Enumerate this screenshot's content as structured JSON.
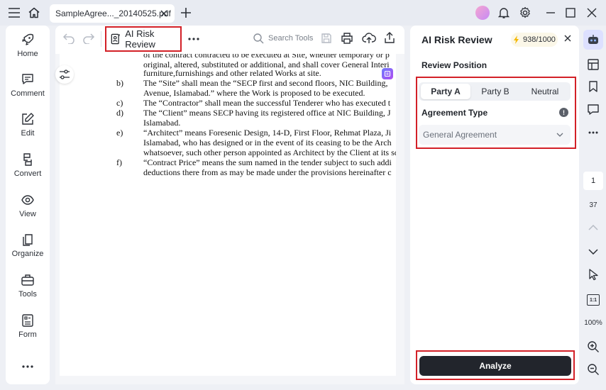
{
  "titlebar": {
    "tab_title": "SampleAgree..._20140525.pdf"
  },
  "sidebar": {
    "items": [
      {
        "label": "Home",
        "icon": "rocket-icon"
      },
      {
        "label": "Comment",
        "icon": "comment-icon"
      },
      {
        "label": "Edit",
        "icon": "edit-icon"
      },
      {
        "label": "Convert",
        "icon": "convert-icon"
      },
      {
        "label": "View",
        "icon": "view-icon"
      },
      {
        "label": "Organize",
        "icon": "organize-icon"
      },
      {
        "label": "Tools",
        "icon": "tools-icon"
      },
      {
        "label": "Form",
        "icon": "form-icon"
      }
    ]
  },
  "toolbar": {
    "ai_risk_review_label": "AI Risk Review",
    "search_placeholder": "Search Tools"
  },
  "document": {
    "lines": [
      {
        "marker": "",
        "text": "of the contract contracted to be executed at Site, whether temporary or p"
      },
      {
        "marker": "",
        "text": "original, altered, substituted or additional, and shall cover General Interi"
      },
      {
        "marker": "",
        "text": "furniture,furnishings and other related Works at site."
      },
      {
        "marker": "b)",
        "text": "The “Site” shall mean the “SECP first and second floors, NIC Building,"
      },
      {
        "marker": "",
        "text": "Avenue, Islamabad.” where the Work is proposed to be executed."
      },
      {
        "marker": "c)",
        "text": "The “Contractor” shall mean the successful Tenderer who has executed t"
      },
      {
        "marker": "d)",
        "text": "The “Client” means SECP having its registered office at NIC Building, J"
      },
      {
        "marker": "",
        "text": "Islamabad."
      },
      {
        "marker": "e)",
        "text": "“Architect” means Foresenic Design, 14-D, First Floor, Rehmat Plaza, Ji"
      },
      {
        "marker": "",
        "text": "Islamabad, who has designed or in the event of its ceasing to be the Arch"
      },
      {
        "marker": "",
        "text": "whatsoever, such other person appointed as Architect by the Client at its sc"
      },
      {
        "marker": "f)",
        "text": " “Contract Price” means the sum named in the tender subject to such addi"
      },
      {
        "marker": "",
        "text": "deductions there from as may be made under the provisions hereinafter c"
      }
    ]
  },
  "panel": {
    "title": "AI Risk Review",
    "credits": "938/1000",
    "review_position_label": "Review Position",
    "positions": [
      "Party A",
      "Party B",
      "Neutral"
    ],
    "agreement_type_label": "Agreement Type",
    "agreement_type_value": "General Agreement",
    "analyze_label": "Analyze"
  },
  "rightbar": {
    "current_page": "1",
    "total_pages": "37",
    "zoom": "100%",
    "fit_label": "1:1"
  },
  "colors": {
    "highlight_red": "#d32027",
    "analyze_bg": "#22252c",
    "credit_bolt": "#f5b800"
  }
}
